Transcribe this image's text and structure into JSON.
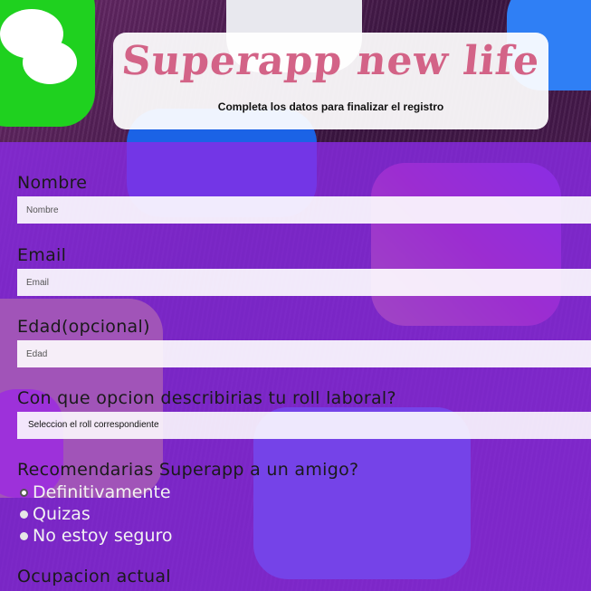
{
  "header": {
    "brand": "Superapp new life",
    "subtitle": "Completa los datos para finalizar el registro"
  },
  "form": {
    "nombre": {
      "label": "Nombre",
      "placeholder": "Nombre"
    },
    "email": {
      "label": "Email",
      "placeholder": "Email"
    },
    "edad": {
      "label": "Edad(opcional)",
      "placeholder": "Edad"
    },
    "roll": {
      "label": "Con que opcion describirias tu roll laboral?",
      "selected": "Seleccion el roll correspondiente"
    },
    "recomienda": {
      "label": "Recomendarias Superapp a un amigo?",
      "options": [
        "Definitivamente",
        "Quizas",
        "No estoy seguro"
      ],
      "selected_index": 0
    },
    "ocupacion": {
      "label": "Ocupacion actual"
    }
  },
  "colors": {
    "brand": "#d36387",
    "panel": "#8a2ae6"
  }
}
